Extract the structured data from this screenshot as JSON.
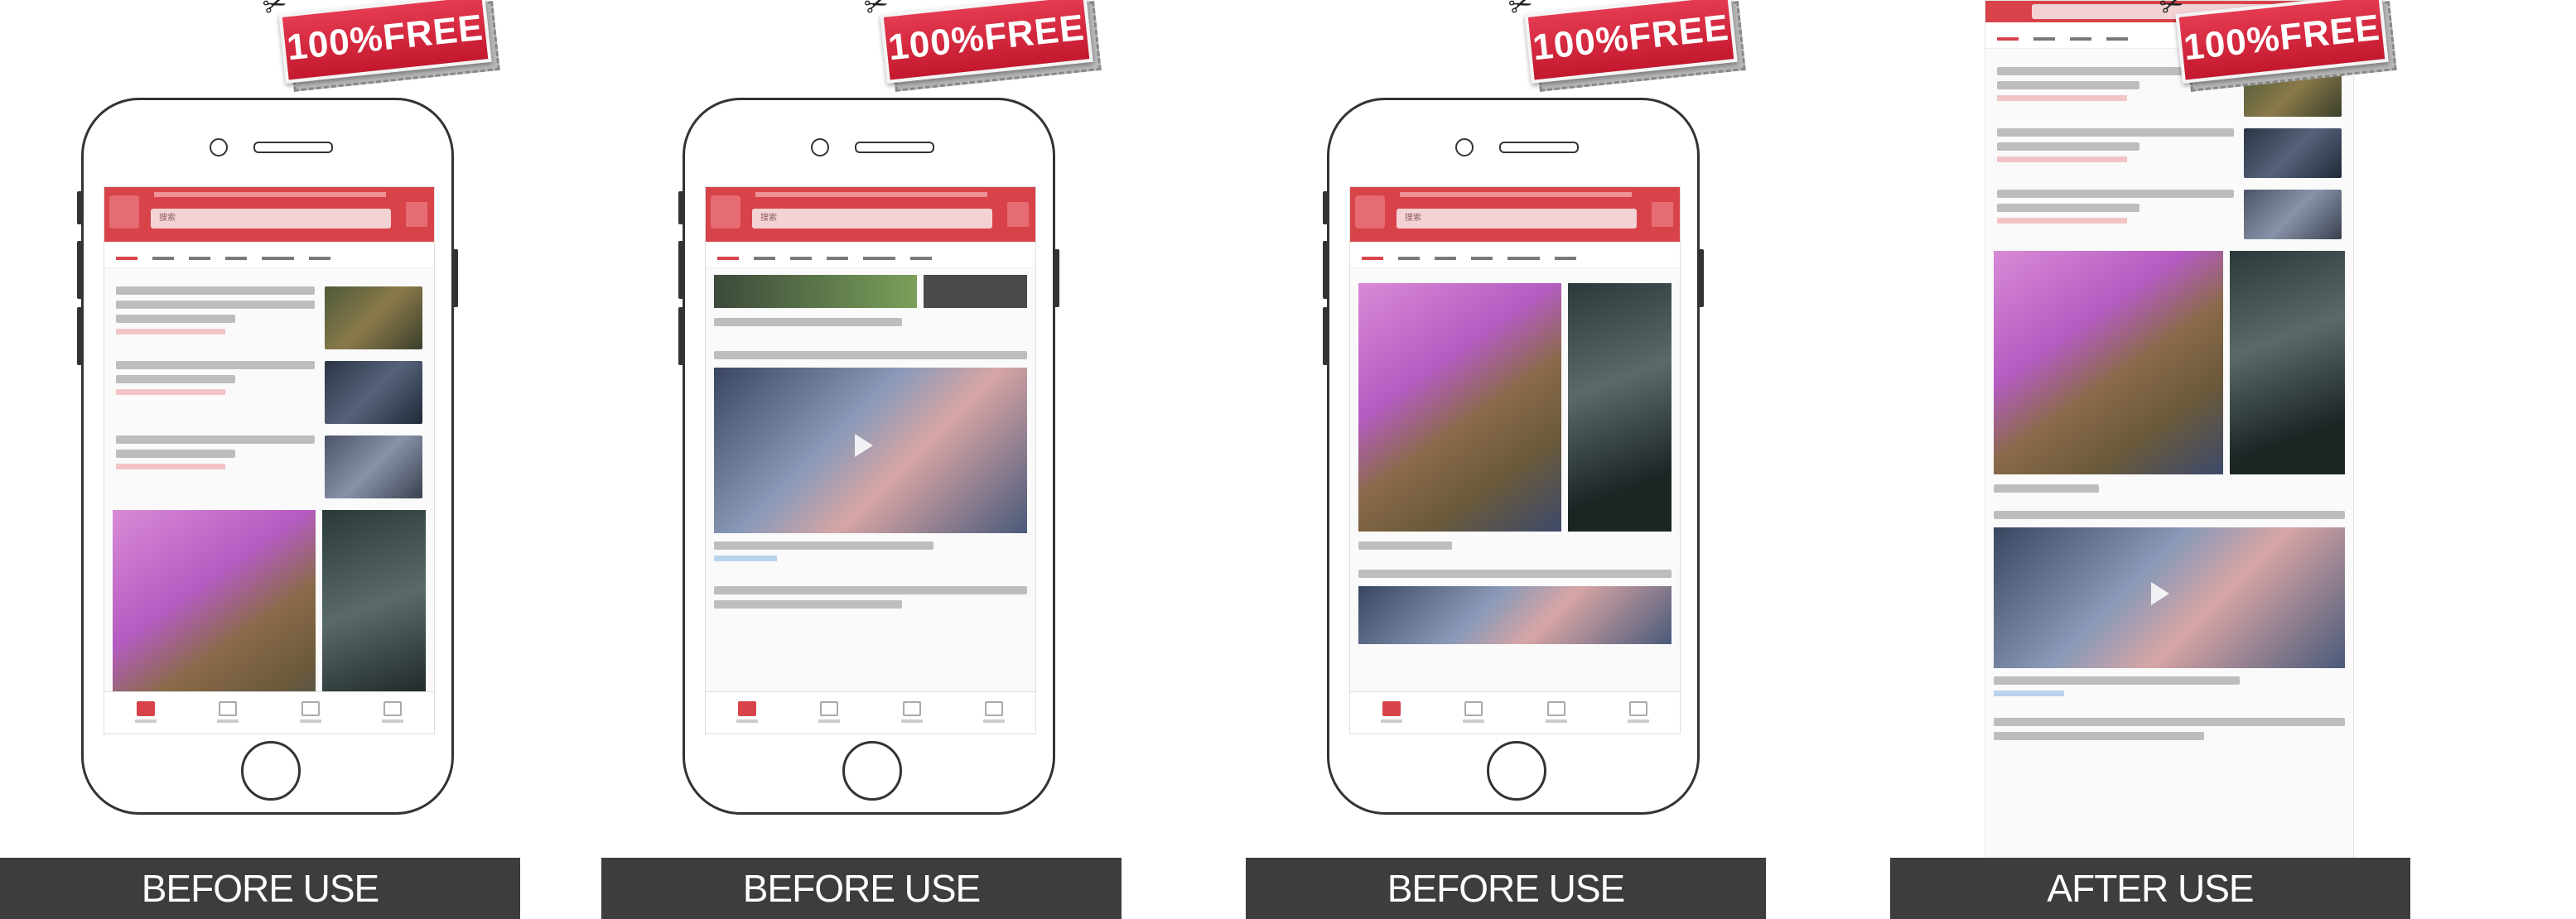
{
  "badge_text": "100%FREE",
  "panels": [
    {
      "caption": "BEFORE USE",
      "search_placeholder": "搜索"
    },
    {
      "caption": "BEFORE USE",
      "search_placeholder": "搜索"
    },
    {
      "caption": "BEFORE USE",
      "search_placeholder": "搜索"
    },
    {
      "caption": "AFTER USE"
    }
  ],
  "colors": {
    "brand_red": "#d8434a",
    "badge_red": "#d32a3e",
    "caption_bg": "#3d3d3d"
  }
}
